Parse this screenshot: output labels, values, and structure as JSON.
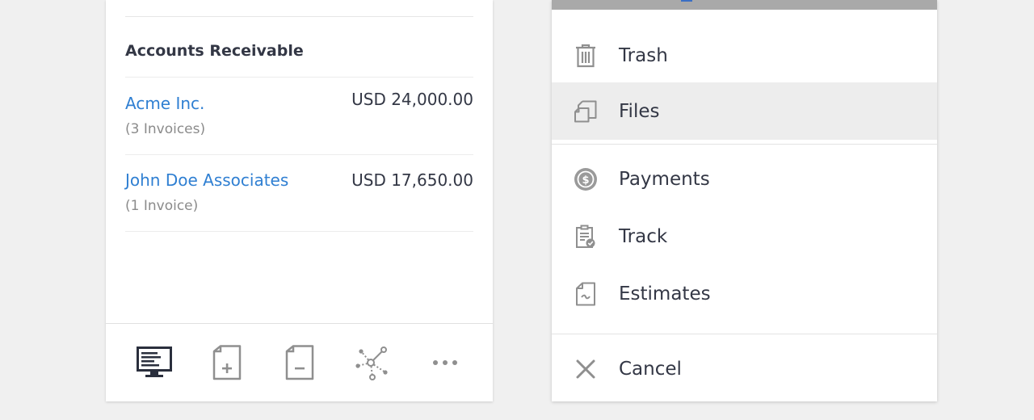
{
  "receivables": {
    "title": "Accounts Receivable",
    "rows": [
      {
        "name": "Acme Inc.",
        "invoices": "(3 Invoices)",
        "amount": "USD 24,000.00"
      },
      {
        "name": "John Doe Associates",
        "invoices": "(1 Invoice)",
        "amount": "USD 17,650.00"
      }
    ]
  },
  "toolbar": {
    "icons": [
      "monitor-icon",
      "new-invoice-icon",
      "credit-note-icon",
      "network-icon",
      "more-icon"
    ]
  },
  "action_sheet": {
    "items": [
      {
        "label": "Trash",
        "icon": "trash-icon"
      },
      {
        "label": "Files",
        "icon": "files-icon",
        "highlighted": true
      },
      {
        "label": "Payments",
        "icon": "payments-icon"
      },
      {
        "label": "Track",
        "icon": "track-icon"
      },
      {
        "label": "Estimates",
        "icon": "estimates-icon"
      },
      {
        "label": "Cancel",
        "icon": "close-icon"
      }
    ]
  },
  "colors": {
    "link": "#2f7fd2",
    "text": "#333745",
    "muted": "#8b8b8b",
    "icon": "#8f8f8f",
    "highlight": "#ededed"
  }
}
